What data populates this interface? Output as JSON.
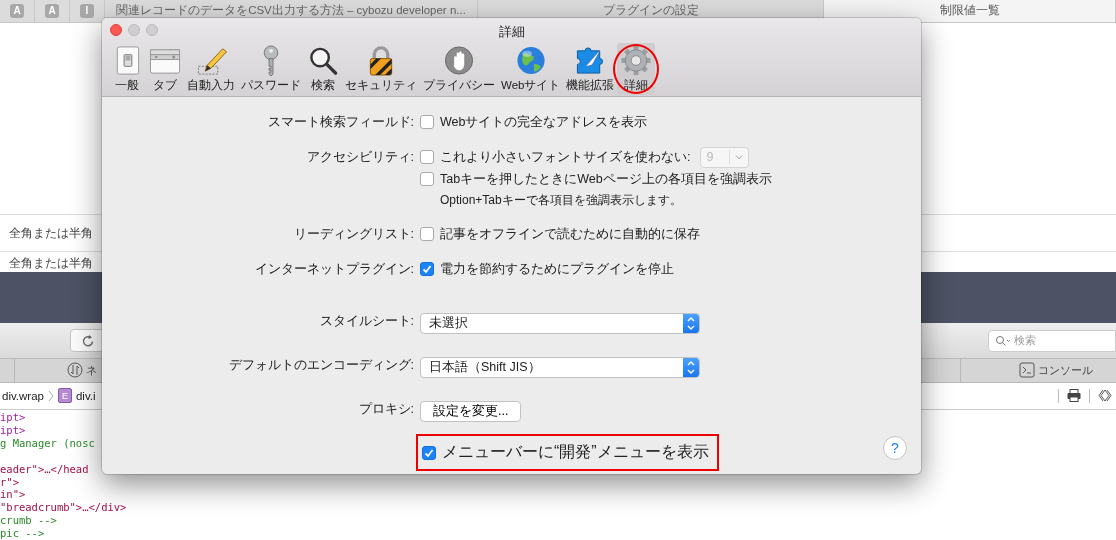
{
  "browser": {
    "pinned_tabs": [
      "A",
      "A",
      "I"
    ],
    "tabs": [
      {
        "title": "関連レコードのデータをCSV出力する方法 – cybozu developer n...",
        "selected": false
      },
      {
        "title": "プラグインの設定",
        "selected": false
      },
      {
        "title": "制限値一覧",
        "selected": true
      }
    ],
    "page_rows": [
      "全角または半角",
      "全角または半角"
    ],
    "search": {
      "placeholder": "検索"
    },
    "devtools": {
      "tabs": [
        {
          "label": "ネ"
        },
        {
          "label": "コンソール"
        }
      ],
      "breadcrumb": [
        {
          "text": "div.wrap"
        },
        {
          "badge": "E",
          "text": "div.i"
        }
      ],
      "code_lines": [
        {
          "text": "ipt>",
          "kind": "tag"
        },
        {
          "text": "ipt>",
          "kind": "tag"
        },
        {
          "text": "g Manager (nosc",
          "kind": "comment"
        },
        {
          "kind": "blank"
        },
        {
          "text": "eader\">…</head",
          "kind": "attr"
        },
        {
          "text": "r\">",
          "kind": "attr"
        },
        {
          "text": "in\">",
          "kind": "attr"
        },
        {
          "text": "\"breadcrumb\">…</div>",
          "kind": "attr"
        },
        {
          "text": "crumb -->",
          "kind": "comment"
        },
        {
          "text": "pic -->",
          "kind": "comment"
        }
      ]
    }
  },
  "dialog": {
    "title": "詳細",
    "toolbar": [
      {
        "label": "一般",
        "selected": false
      },
      {
        "label": "タブ",
        "selected": false
      },
      {
        "label": "自動入力",
        "selected": false
      },
      {
        "label": "パスワード",
        "selected": false
      },
      {
        "label": "検索",
        "selected": false
      },
      {
        "label": "セキュリティ",
        "selected": false
      },
      {
        "label": "プライバシー",
        "selected": false
      },
      {
        "label": "Webサイト",
        "selected": false
      },
      {
        "label": "機能拡張",
        "selected": false
      },
      {
        "label": "詳細",
        "selected": true,
        "annotated": true
      }
    ],
    "sections": [
      [
        {
          "label": "スマート検索フィールド:",
          "controls": [
            {
              "kind": "checkbox",
              "text": "Webサイトの完全なアドレスを表示",
              "checked": false
            }
          ]
        },
        {
          "label": "アクセシビリティ:",
          "controls": [
            {
              "kind": "checkbox",
              "text": "これより小さいフォントサイズを使わない:",
              "checked": false,
              "popup": {
                "value": "9",
                "disabled": true
              }
            },
            {
              "kind": "checkbox",
              "text": "Tabキーを押したときにWebページ上の各項目を強調表示",
              "checked": false
            },
            {
              "kind": "note",
              "text": "Option+Tabキーで各項目を強調表示します。"
            }
          ]
        },
        {
          "label": "リーディングリスト:",
          "controls": [
            {
              "kind": "checkbox",
              "text": "記事をオフラインで読むために自動的に保存",
              "checked": false
            }
          ]
        },
        {
          "label": "インターネットプラグイン:",
          "controls": [
            {
              "kind": "checkbox",
              "text": "電力を節約するためにプラグインを停止",
              "checked": true
            }
          ]
        }
      ],
      [
        {
          "label": "スタイルシート:",
          "controls": [
            {
              "kind": "popup",
              "value": "未選択"
            }
          ]
        },
        {
          "label": "デフォルトのエンコーディング:",
          "controls": [
            {
              "kind": "popup",
              "value": "日本語（Shift JIS）"
            }
          ]
        },
        {
          "label": "プロキシ:",
          "controls": [
            {
              "kind": "button",
              "text": "設定を変更..."
            }
          ]
        },
        {
          "controls": [
            {
              "kind": "checkbox",
              "text": "メニューバーに“開発”メニューを表示",
              "checked": true,
              "annotated": true
            }
          ]
        }
      ]
    ],
    "help": "?"
  }
}
